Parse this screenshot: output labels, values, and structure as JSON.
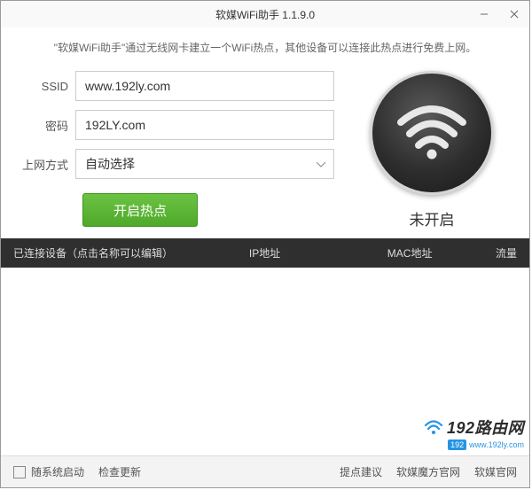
{
  "title": "软媒WiFi助手 1.1.9.0",
  "description": "\"软媒WiFi助手\"通过无线网卡建立一个WiFi热点，其他设备可以连接此热点进行免费上网。",
  "form": {
    "ssid_label": "SSID",
    "ssid_value": "www.192ly.com",
    "password_label": "密码",
    "password_value": "192LY.com",
    "method_label": "上网方式",
    "method_value": "自动选择",
    "start_button": "开启热点"
  },
  "status": {
    "text": "未开启"
  },
  "table": {
    "col1": "已连接设备（点击名称可以编辑）",
    "col2": "IP地址",
    "col3": "MAC地址",
    "col4": "流量"
  },
  "footer": {
    "autostart": "随系统启动",
    "check_update": "检查更新",
    "feedback": "提点建议",
    "ruanmei_mofang": "软媒魔方官网",
    "ruanmei": "软媒官网"
  },
  "watermark": {
    "brand": "192路由网",
    "url": "www.192ly.com",
    "badge": "192"
  }
}
